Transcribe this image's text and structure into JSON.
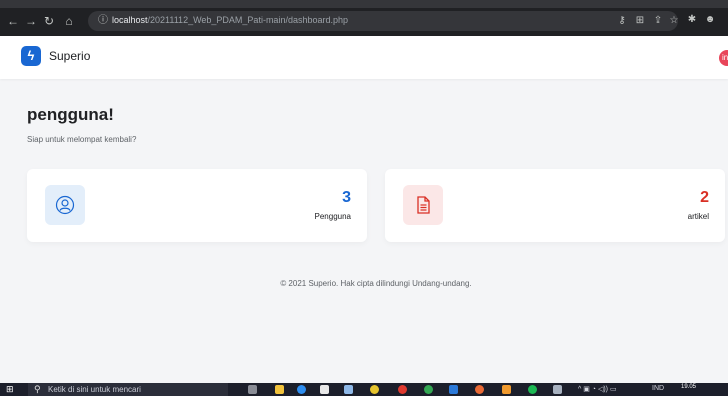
{
  "browser": {
    "url_host": "localhost",
    "url_path": "/20211112_Web_PDAM_Pati-main/dashboard.php"
  },
  "app": {
    "logo_glyph": "ϟ",
    "brand": "Superio",
    "avatar_initial": "in",
    "accent": "#1967d2"
  },
  "main": {
    "greeting": "pengguna!",
    "subtitle": "Siap untuk melompat kembali?",
    "cards": [
      {
        "count": "3",
        "label": "Pengguna",
        "icon": "user-icon",
        "color": "#1967d2"
      },
      {
        "count": "2",
        "label": "artikel",
        "icon": "document-icon",
        "color": "#d93025"
      }
    ]
  },
  "footer": {
    "text": "© 2021 Superio. Hak cipta dilindungi Undang-undang."
  },
  "taskbar": {
    "search_placeholder": "Ketik di sini untuk mencari",
    "language": "IND",
    "time": "19.05"
  }
}
